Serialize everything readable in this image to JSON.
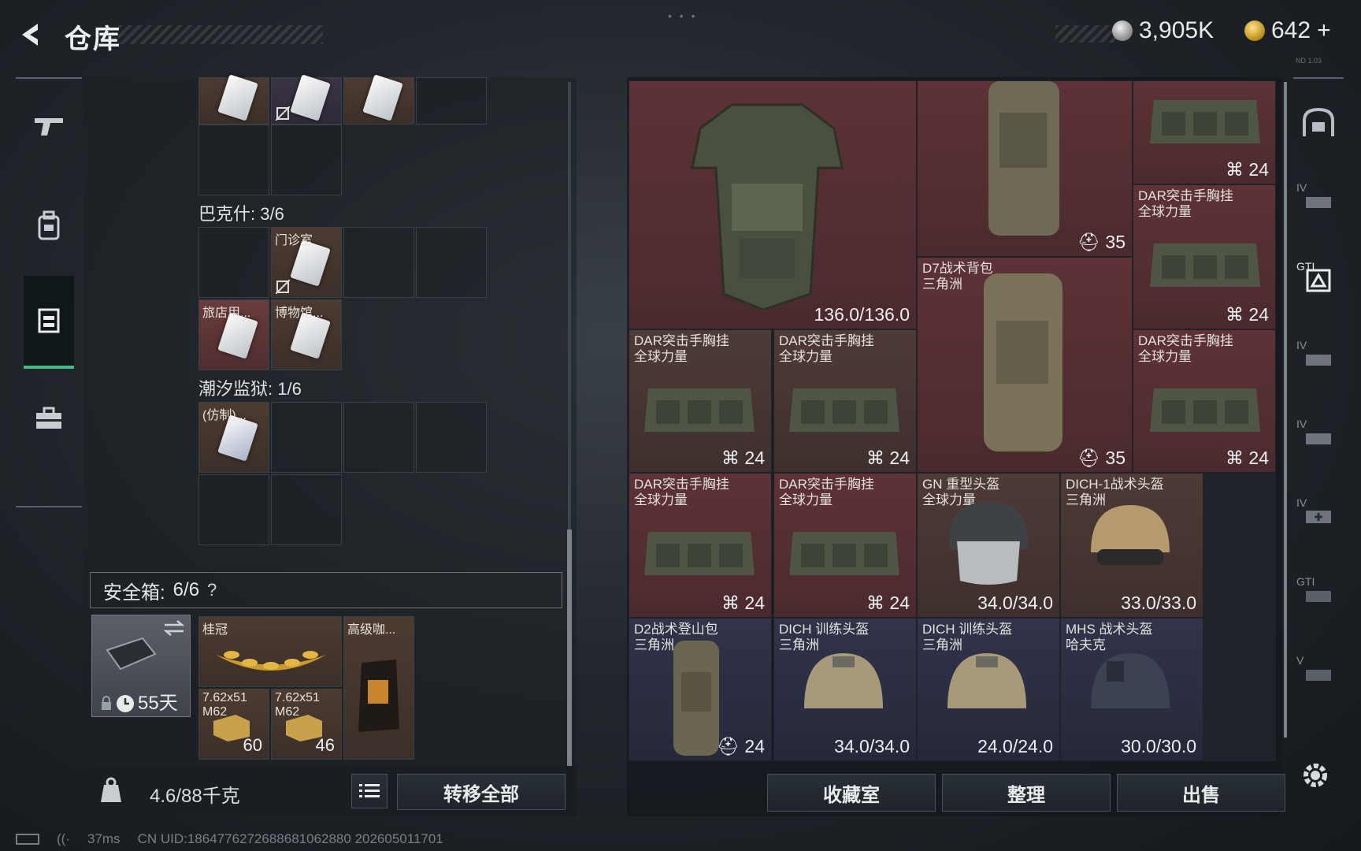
{
  "header": {
    "title": "仓库",
    "currency1_value": "3,905K",
    "currency2_value": "642",
    "currency2_plus": "+",
    "tiny_code": "ND 1.03"
  },
  "left_nav": [
    "gun-icon",
    "backpack-icon",
    "chest-rig-icon",
    "briefcase-icon"
  ],
  "left_panel": {
    "top_row_cells": 4,
    "section_baks": "巴克什: 3/6",
    "baks_items": [
      {
        "label": "门诊室"
      },
      {
        "label": "旅店用..."
      },
      {
        "label": "博物馆..."
      }
    ],
    "section_tide": "潮汐监狱: 1/6",
    "tide_items": [
      {
        "label": "(仿制)..."
      }
    ],
    "safe_box_label": "安全箱:",
    "safe_box_count": "6/6",
    "safe_box_help": "?",
    "safe_case_days": "55天",
    "safe_items": [
      {
        "label": "桂冠",
        "value": ""
      },
      {
        "label": "高级咖...",
        "value": ""
      },
      {
        "label": "7.62x51\nM62",
        "value": "60"
      },
      {
        "label": "7.62x51\nM62",
        "value": "46"
      }
    ],
    "weight": "4.6/88千克",
    "transfer_all": "转移全部"
  },
  "status_bar": {
    "ping": "37ms",
    "uid": "CN UID:1864776272688681062880 202605011701"
  },
  "right_panel": {
    "items": [
      {
        "id": "vest",
        "label": "",
        "value": "136.0/136.0"
      },
      {
        "id": "bag-top",
        "label": "",
        "value": "35"
      },
      {
        "id": "rig-top",
        "label": "",
        "value": "24"
      },
      {
        "id": "rig-r2",
        "label": "DAR突击手胸挂\n全球力量",
        "value": "24"
      },
      {
        "id": "d7",
        "label": "D7战术背包\n三角洲",
        "value": "35"
      },
      {
        "id": "rig-a",
        "label": "DAR突击手胸挂\n全球力量",
        "value": "24"
      },
      {
        "id": "rig-b",
        "label": "DAR突击手胸挂\n全球力量",
        "value": "24"
      },
      {
        "id": "rig-r3",
        "label": "DAR突击手胸挂\n全球力量",
        "value": "24"
      },
      {
        "id": "rig-c",
        "label": "DAR突击手胸挂\n全球力量",
        "value": "24"
      },
      {
        "id": "rig-d",
        "label": "DAR突击手胸挂\n全球力量",
        "value": "24"
      },
      {
        "id": "gn",
        "label": "GN 重型头盔\n全球力量",
        "value": "34.0/34.0"
      },
      {
        "id": "dich1",
        "label": "DICH-1战术头盔\n三角洲",
        "value": "33.0/33.0"
      },
      {
        "id": "d2",
        "label": "D2战术登山包\n三角洲",
        "value": "24"
      },
      {
        "id": "dich-a",
        "label": "DICH 训练头盔\n三角洲",
        "value": "34.0/34.0"
      },
      {
        "id": "dich-b",
        "label": "DICH 训练头盔\n三角洲",
        "value": "24.0/24.0"
      },
      {
        "id": "mhs",
        "label": "MHS 战术头盔\n哈夫克",
        "value": "30.0/30.0"
      }
    ],
    "buttons": {
      "collection": "收藏室",
      "sort": "整理",
      "sell": "出售"
    }
  },
  "right_nav": [
    "helmet-slot-icon",
    "IV",
    "GTI",
    "IV",
    "IV",
    "IV",
    "GTI",
    "V",
    "settings-icon"
  ],
  "colors": {
    "accent_green": "#3fbd84",
    "rarity_red": "#5e3236",
    "rarity_purple": "#31344a",
    "rarity_gold": "#4d3b31"
  }
}
